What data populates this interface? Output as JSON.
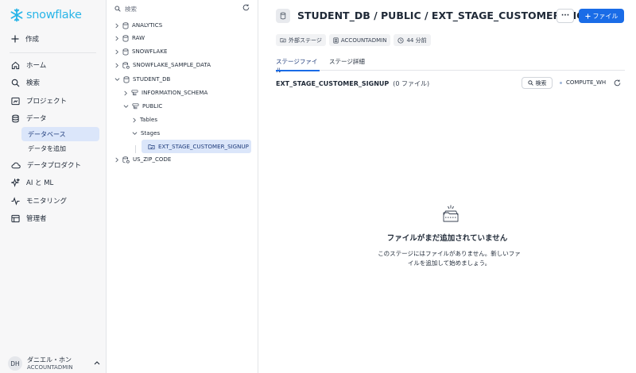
{
  "brand": {
    "name": "snowflake",
    "color": "#29b5e8",
    "accent": "#1a6ce7"
  },
  "sidebar": {
    "create_label": "作成",
    "items": [
      {
        "label": "ホーム",
        "icon": "home-icon"
      },
      {
        "label": "検索",
        "icon": "search-icon"
      },
      {
        "label": "プロジェクト",
        "icon": "projects-icon"
      },
      {
        "label": "データ",
        "icon": "data-icon"
      },
      {
        "label": "データプロダクト",
        "icon": "cloud-icon"
      },
      {
        "label": "AI と ML",
        "icon": "sparkle-icon"
      },
      {
        "label": "モニタリング",
        "icon": "activity-icon"
      },
      {
        "label": "管理者",
        "icon": "admin-icon"
      }
    ],
    "data_sub": [
      {
        "label": "データベース",
        "active": true
      },
      {
        "label": "データを追加",
        "active": false
      }
    ],
    "user": {
      "initials": "DH",
      "name": "ダニエル・ホン",
      "role": "ACCOUNTADMIN"
    }
  },
  "tree": {
    "search_placeholder": "検索",
    "nodes": [
      {
        "label": "ANALYTICS",
        "level": 0,
        "expanded": false,
        "icon": "database-icon"
      },
      {
        "label": "RAW",
        "level": 0,
        "expanded": false,
        "icon": "database-icon"
      },
      {
        "label": "SNOWFLAKE",
        "level": 0,
        "expanded": false,
        "icon": "database-icon"
      },
      {
        "label": "SNOWFLAKE_SAMPLE_DATA",
        "level": 0,
        "expanded": false,
        "icon": "shared-database-icon"
      },
      {
        "label": "STUDENT_DB",
        "level": 0,
        "expanded": true,
        "icon": "database-icon"
      },
      {
        "label": "INFORMATION_SCHEMA",
        "level": 1,
        "expanded": false,
        "icon": "schema-icon"
      },
      {
        "label": "PUBLIC",
        "level": 1,
        "expanded": true,
        "icon": "schema-icon"
      },
      {
        "label": "Tables",
        "level": 2,
        "expanded": false,
        "icon": ""
      },
      {
        "label": "Stages",
        "level": 2,
        "expanded": true,
        "icon": ""
      },
      {
        "label": "EXT_STAGE_CUSTOMER_SIGNUP",
        "level": 3,
        "selected": true,
        "icon": "stage-icon"
      },
      {
        "label": "US_ZIP_CODE",
        "level": 0,
        "expanded": false,
        "icon": "shared-database-icon"
      }
    ]
  },
  "main": {
    "title": "STUDENT_DB / PUBLIC / EXT_STAGE_CUSTOMER_SIGNUP",
    "more_label": "···",
    "file_button_label": "ファイル",
    "chips": [
      {
        "label": "外部ステージ",
        "icon": "stage-icon"
      },
      {
        "label": "ACCOUNTADMIN",
        "icon": "role-icon"
      },
      {
        "label": "44 分前",
        "icon": "clock-icon"
      }
    ],
    "tabs": [
      {
        "label": "ステージファイル",
        "active": true
      },
      {
        "label": "ステージ詳細",
        "active": false
      }
    ],
    "stage_name": "EXT_STAGE_CUSTOMER_SIGNUP",
    "file_count": "(0 ファイル)",
    "search_label": "検索",
    "warehouse": "COMPUTE_WH",
    "empty": {
      "title": "ファイルがまだ追加されていません",
      "description_line1": "このステージにはファイルがありません。新しいファ",
      "description_line2": "イルを追加して始めましょう。"
    }
  }
}
